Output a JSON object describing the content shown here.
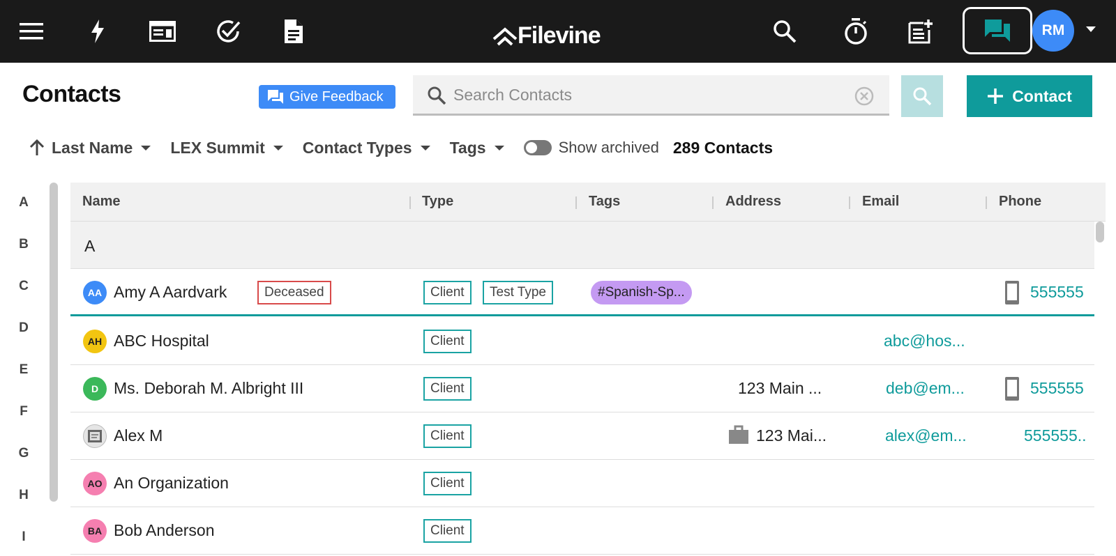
{
  "app": {
    "logo_text": "Filevine"
  },
  "topbar": {
    "left_icons": [
      "menu-icon",
      "bolt-icon",
      "dashboard-icon",
      "check-circle-icon",
      "document-icon"
    ],
    "right_icons": [
      "search-icon",
      "timer-icon",
      "note-add-icon",
      "chat-icon"
    ],
    "user_initials": "RM"
  },
  "header": {
    "title": "Contacts",
    "feedback_label": "Give Feedback",
    "search_placeholder": "Search Contacts",
    "search_value": "",
    "add_contact_label": "Contact"
  },
  "filters": {
    "sort_label": "Last Name",
    "org_label": "LEX Summit",
    "types_label": "Contact Types",
    "tags_label": "Tags",
    "show_archived_label": "Show archived",
    "show_archived": false,
    "count_label": "289 Contacts"
  },
  "alphabet": [
    "A",
    "B",
    "C",
    "D",
    "E",
    "F",
    "G",
    "H",
    "I"
  ],
  "table": {
    "columns": [
      "Name",
      "Type",
      "Tags",
      "Address",
      "Email",
      "Phone"
    ],
    "group_label": "A",
    "rows": [
      {
        "initials": "AA",
        "avatar_color": "#3d8bf7",
        "name": "Amy A Aardvark",
        "status": "Deceased",
        "types": [
          "Client",
          "Test Type"
        ],
        "tag": "#Spanish-Sp...",
        "address": "",
        "email": "",
        "phone": "555555"
      },
      {
        "initials": "AH",
        "avatar_color": "#f2c511",
        "name": "ABC Hospital",
        "types": [
          "Client"
        ],
        "email": "abc@hos..."
      },
      {
        "initials": "D",
        "avatar_color": "#3bb85a",
        "name": "Ms. Deborah M. Albright III",
        "types": [
          "Client"
        ],
        "address": "123 Main ...",
        "email": "deb@em...",
        "phone": "555555"
      },
      {
        "initials": "",
        "avatar_color": "#e5e5e5",
        "name": "Alex M",
        "types": [
          "Client"
        ],
        "address": "123 Mai...",
        "email": "alex@em...",
        "phone": "555555.."
      },
      {
        "initials": "AO",
        "avatar_color": "#f57fb0",
        "name": "An Organization",
        "types": [
          "Client"
        ]
      },
      {
        "initials": "BA",
        "avatar_color": "#f57fb0",
        "name": "Bob Anderson",
        "types": [
          "Client"
        ]
      }
    ]
  },
  "colors": {
    "topbar": "#1a1a1a",
    "accent": "#0f9b9b",
    "feedback": "#3d8bf7",
    "tag_purple": "#c49af2",
    "deceased_red": "#d84a4a"
  }
}
